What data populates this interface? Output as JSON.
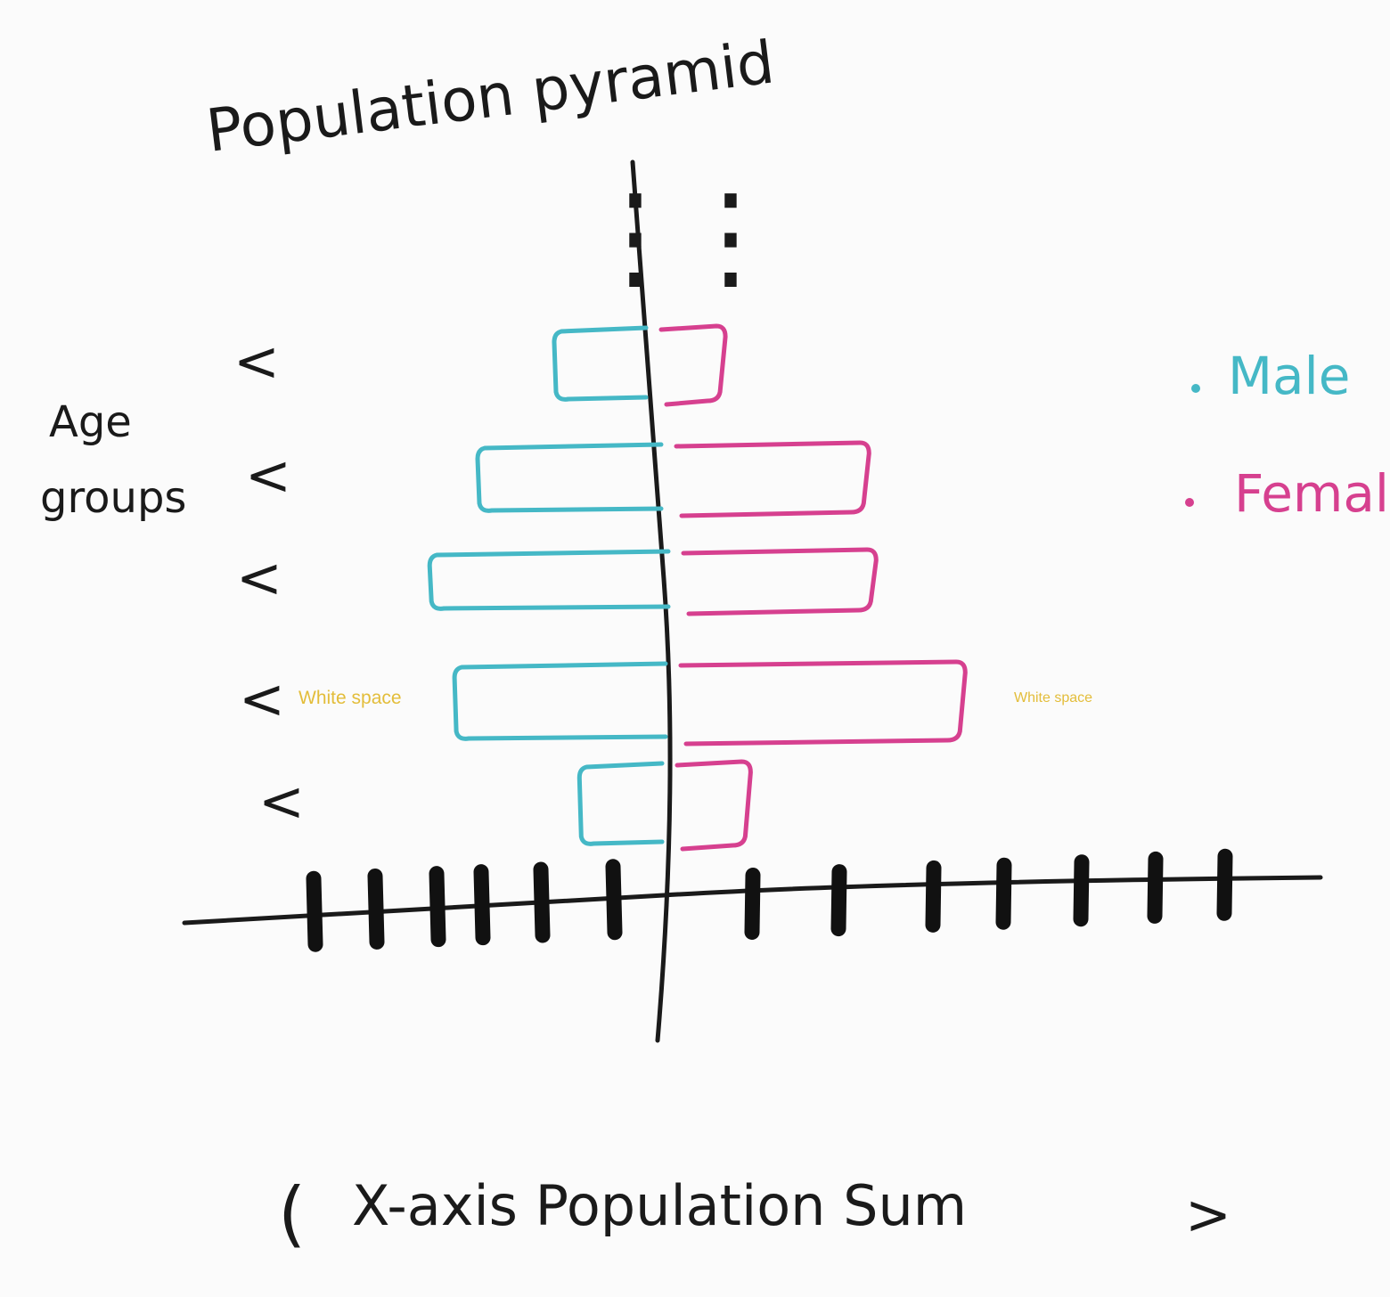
{
  "title": "Population pyramid",
  "y_axis_label_line1": "Age",
  "y_axis_label_line2": "groups",
  "x_axis_label": "X-axis Population Sum",
  "x_axis_left_arrow": "(",
  "x_axis_right_arrow": ">",
  "age_group_marker": "<",
  "annotation_left": "White space",
  "annotation_right": "White space",
  "continuation_mark": "⋮",
  "colors": {
    "male": "#45b8c6",
    "female": "#d6408f",
    "ink": "#1a1a1a",
    "annotation": "#e3bd3a"
  },
  "chart_data": {
    "type": "bar",
    "orientation": "horizontal-diverging",
    "title": "Population pyramid",
    "ylabel": "Age groups",
    "xlabel": "X-axis Population Sum",
    "legend": {
      "placement": "right",
      "entries": [
        "Male",
        "Female"
      ]
    },
    "categories": [
      "<",
      "<",
      "<",
      "<",
      "<"
    ],
    "series": [
      {
        "name": "Male",
        "color": "#45b8c6",
        "values": [
          1.0,
          2.0,
          2.6,
          2.3,
          0.9
        ]
      },
      {
        "name": "Female",
        "color": "#d6408f",
        "values": [
          0.7,
          2.1,
          2.1,
          3.1,
          0.8
        ]
      }
    ],
    "x_ticks_left": 6,
    "x_ticks_right": 8,
    "tick_labels_shown": false
  }
}
